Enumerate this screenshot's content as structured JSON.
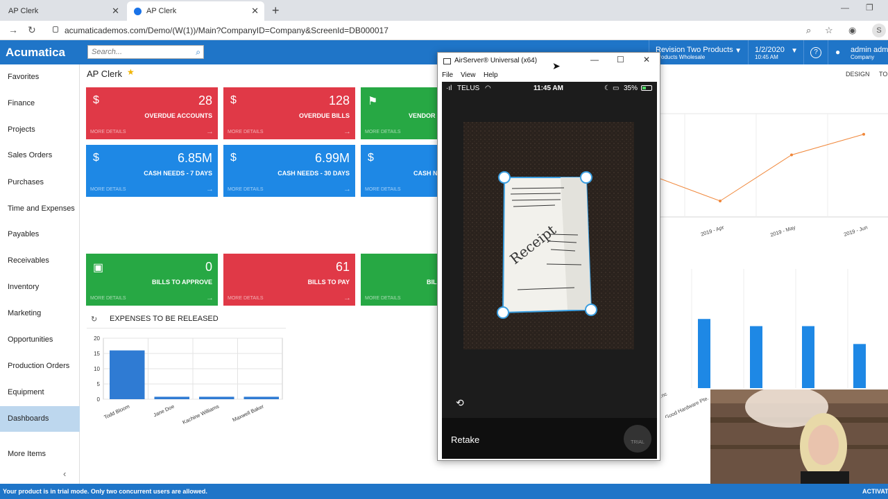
{
  "browser": {
    "tabs": [
      {
        "label": "AP Clerk",
        "active": false
      },
      {
        "label": "AP Clerk",
        "active": true
      }
    ],
    "new_tab": "+",
    "url": "acumaticademos.com/Demo/(W(1))/Main?CompanyID=Company&ScreenId=DB000017",
    "profile_initial": "S"
  },
  "app": {
    "logo": "Acumatica",
    "search_placeholder": "Search...",
    "company": {
      "name": "Revision Two Products",
      "sub": "Products Wholesale"
    },
    "date": {
      "date": "1/2/2020",
      "time": "10:45 AM"
    },
    "help": "?",
    "user": {
      "name": "admin admin",
      "sub": "Company"
    },
    "design_link": "DESIGN",
    "tools_link": "TO"
  },
  "sidebar": {
    "items": [
      {
        "label": "Favorites"
      },
      {
        "label": "Finance"
      },
      {
        "label": "Projects"
      },
      {
        "label": "Sales Orders"
      },
      {
        "label": "Purchases"
      },
      {
        "label": "Time and Expenses"
      },
      {
        "label": "Payables"
      },
      {
        "label": "Receivables"
      },
      {
        "label": "Inventory"
      },
      {
        "label": "Marketing"
      },
      {
        "label": "Opportunities"
      },
      {
        "label": "Production Orders"
      },
      {
        "label": "Equipment"
      },
      {
        "label": "Dashboards"
      }
    ],
    "more_items": "More Items",
    "collapse": "‹"
  },
  "page": {
    "title": "AP Clerk",
    "tiles": [
      {
        "cur": "$",
        "value": "28",
        "label": "OVERDUE ACCOUNTS",
        "more": "MORE DETAILS",
        "color": "red"
      },
      {
        "cur": "$",
        "value": "128",
        "label": "OVERDUE BILLS",
        "more": "MORE DETAILS",
        "color": "red"
      },
      {
        "cur": "⚑",
        "value": "",
        "label": "VENDOR",
        "more": "MORE DETAILS",
        "color": "green"
      },
      {
        "cur": "$",
        "value": "6.85M",
        "label": "CASH NEEDS - 7 DAYS",
        "more": "MORE DETAILS",
        "color": "blue"
      },
      {
        "cur": "$",
        "value": "6.99M",
        "label": "CASH NEEDS - 30 DAYS",
        "more": "MORE DETAILS",
        "color": "blue"
      },
      {
        "cur": "$",
        "value": "",
        "label": "CASH N",
        "more": "MORE DETAILS",
        "color": "blue"
      },
      {
        "cur": "▣",
        "value": "0",
        "label": "BILLS TO APPROVE",
        "more": "MORE DETAILS",
        "color": "green"
      },
      {
        "cur": "",
        "value": "61",
        "label": "BILLS TO PAY",
        "more": "MORE DETAILS",
        "color": "red"
      },
      {
        "cur": "",
        "value": "",
        "label": "BIL",
        "more": "MORE DETAILS",
        "color": "green"
      }
    ],
    "expenses_title": "EXPENSES TO BE RELEASED"
  },
  "chart_data": [
    {
      "type": "bar",
      "title": "EXPENSES TO BE RELEASED",
      "categories": [
        "Todd Bloom",
        "Jane Doe",
        "Kachine Williams",
        "Maxwell Baker"
      ],
      "values": [
        16,
        0.8,
        0.8,
        0.8
      ],
      "ylim": [
        0,
        20
      ],
      "yticks": [
        0,
        5,
        10,
        15,
        20
      ],
      "grid": true,
      "color": "#2f7bd3"
    },
    {
      "type": "line",
      "categories": [
        "2019 - Apr",
        "2019 - May",
        "2019 - Jun"
      ],
      "values": [
        20,
        58,
        75
      ],
      "ylim": [
        0,
        100
      ],
      "color": "#f0873a",
      "note_partial": true
    },
    {
      "type": "bar",
      "categories": [
        "...nc",
        "Good Hardware Pte."
      ],
      "values": [
        58,
        52,
        52,
        37
      ],
      "ylim": [
        0,
        100
      ],
      "color": "#1e88e5"
    }
  ],
  "airserver": {
    "title": "AirServer® Universal (x64)",
    "menu": [
      "File",
      "View",
      "Help"
    ],
    "status": {
      "carrier": "TELUS",
      "time": "11:45 AM",
      "battery": "35%"
    },
    "receipt_text": "Receipt",
    "retake": "Retake",
    "trial": "TRIAL"
  },
  "footer": {
    "message": "Your product is in trial mode. Only two concurrent users are allowed.",
    "activate": "ACTIVAT"
  }
}
